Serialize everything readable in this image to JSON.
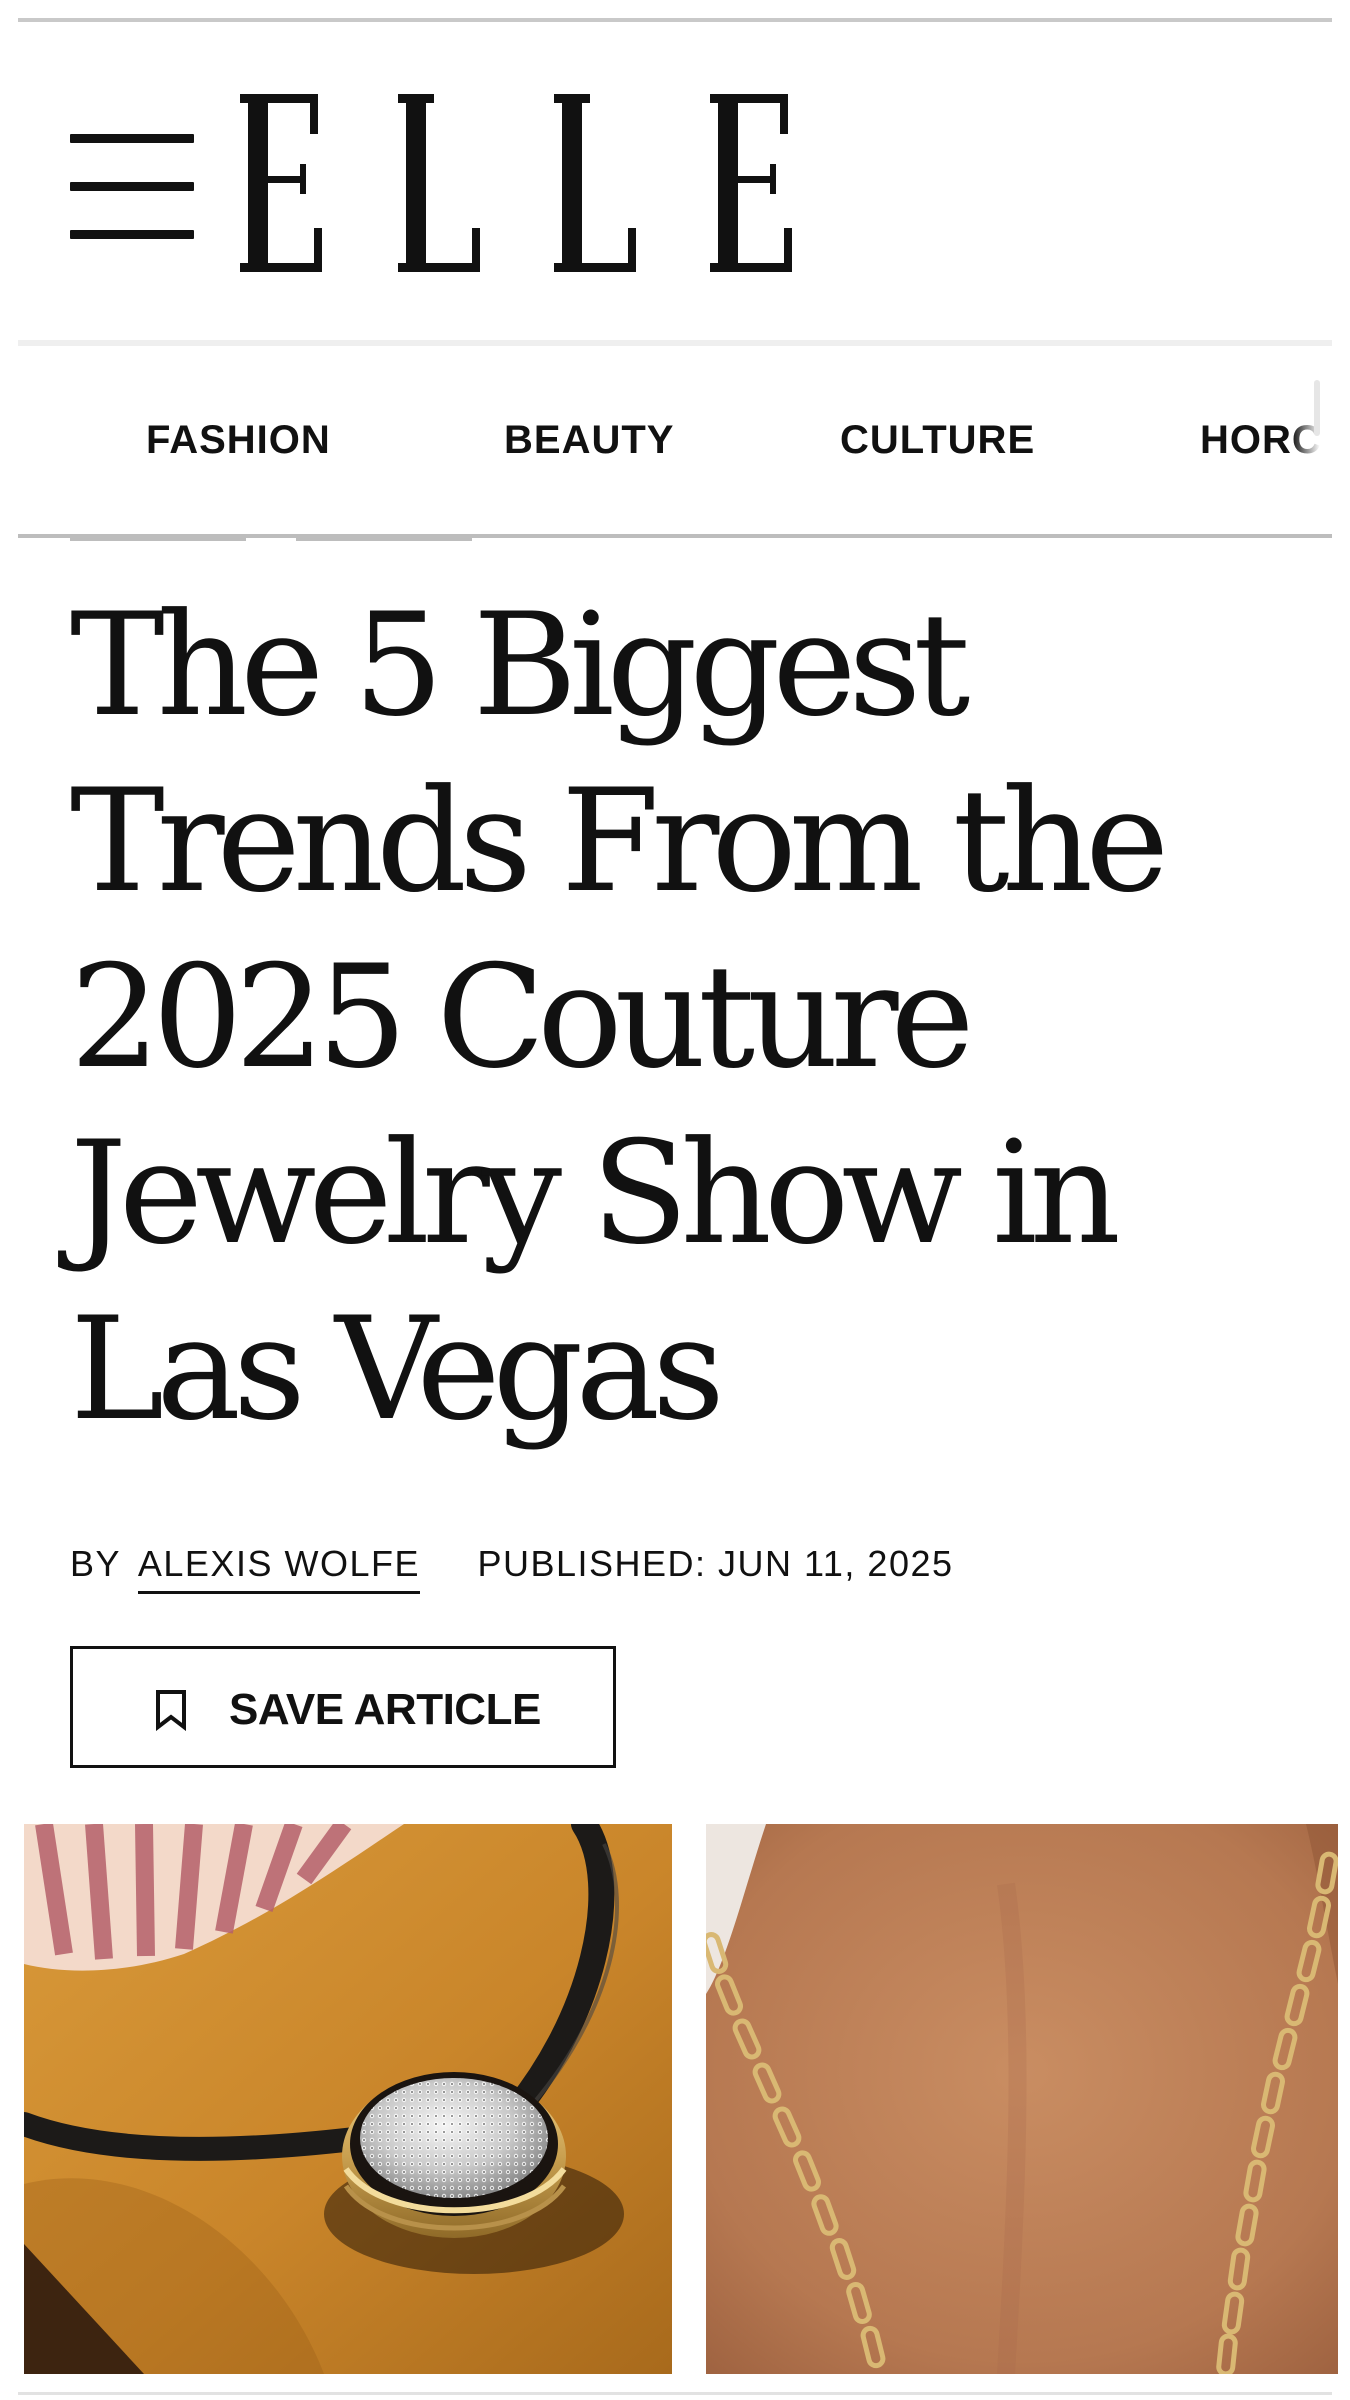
{
  "site": {
    "logo_text": "ELLE"
  },
  "icons": {
    "menu": "hamburger-menu-icon",
    "save": "bookmark-icon"
  },
  "nav": {
    "items": [
      {
        "label": "FASHION"
      },
      {
        "label": "BEAUTY"
      },
      {
        "label": "CULTURE"
      },
      {
        "label": "HORC"
      }
    ]
  },
  "article": {
    "title_lines": [
      "The 5 Biggest",
      "Trends From the",
      "2025 Couture",
      "Jewelry Show in",
      "Las Vegas"
    ],
    "byline_prefix": "BY",
    "author": "ALEXIS WOLFE",
    "published": "PUBLISHED: JUN 11, 2025",
    "save_label": "SAVE ARTICLE"
  },
  "colors": {
    "text": "#111111",
    "rule": "#bdbdbd",
    "background": "#ffffff"
  }
}
